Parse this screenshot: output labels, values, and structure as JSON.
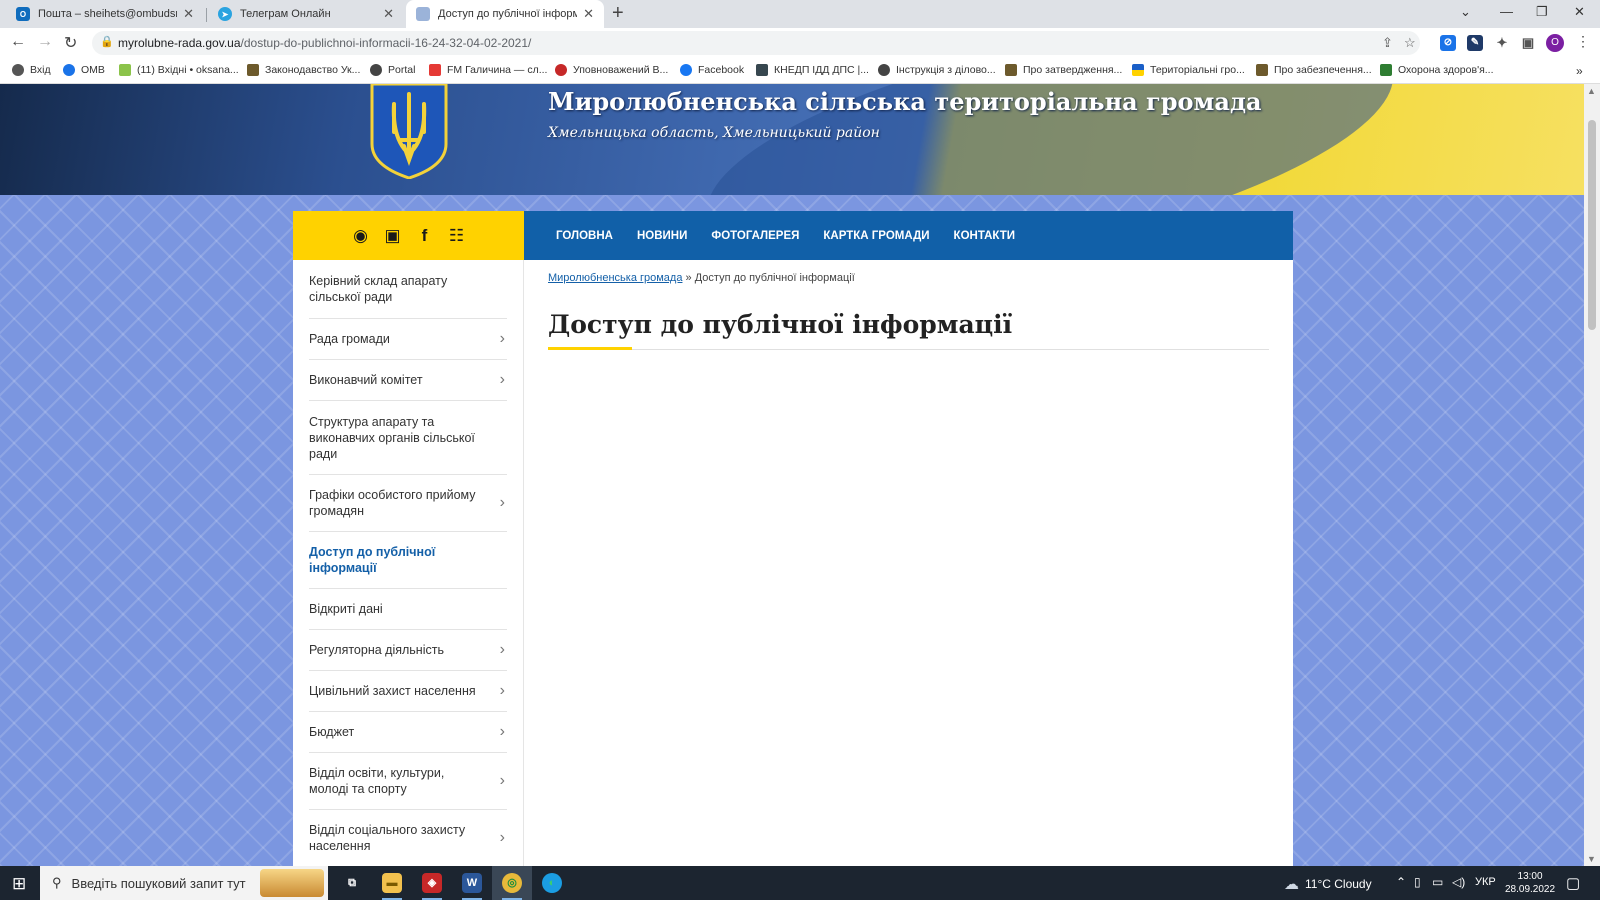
{
  "browser": {
    "tabs": [
      {
        "label": "Пошта – sheihets@ombudsman.",
        "favicon": "outlook-icon",
        "color": "#0f6cbd"
      },
      {
        "label": "Телеграм Онлайн",
        "favicon": "telegram-icon",
        "color": "#2aa3e0"
      },
      {
        "label": "Доступ до публічної інформації",
        "favicon": "page-icon",
        "color": "#9bb3d9"
      }
    ],
    "close_glyph": "✕",
    "new_tab_glyph": "+",
    "window_controls": {
      "tab_search": "⌄",
      "minimize": "—",
      "restore": "❐",
      "close": "✕"
    },
    "nav": {
      "back": "←",
      "forward": "→",
      "reload": "↻"
    },
    "url_host": "myrolubne-rada.gov.ua",
    "url_path": "/dostup-do-publichnoi-informacii-16-24-32-04-02-2021/",
    "omnibox_icons": {
      "lock": "🔒",
      "share": "⇪",
      "star": "☆"
    },
    "extensions": [
      {
        "name": "cloud-extension-icon",
        "glyph": "⊘",
        "color": "#1a73e8"
      },
      {
        "name": "edit-extension-icon",
        "glyph": "✎",
        "color": "#1f3a68"
      },
      {
        "name": "puzzle-icon",
        "glyph": "✦",
        "color": "#555555"
      },
      {
        "name": "sidepanel-icon",
        "glyph": "▣",
        "color": "#555555"
      }
    ],
    "profile_initial": "O",
    "menu_glyph": "⋮",
    "bookmarks": [
      {
        "label": "Вхід",
        "color": "#555555"
      },
      {
        "label": "OMB",
        "color": "#1a73e8"
      },
      {
        "label": "(11) Вхідні • oksana...",
        "color": "#8bc34a"
      },
      {
        "label": "Законодавство Ук...",
        "color": "#6d5a2c"
      },
      {
        "label": "Portal",
        "color": "#444444"
      },
      {
        "label": "FM Галичина — сл...",
        "color": "#e53935"
      },
      {
        "label": "Уповноважений В...",
        "color": "#c62828"
      },
      {
        "label": "Facebook",
        "color": "#1877f2"
      },
      {
        "label": "КНЕДП ІДД ДПС |...",
        "color": "#37474f"
      },
      {
        "label": "Інструкція з ділово...",
        "color": "#444444"
      },
      {
        "label": "Про затвердження...",
        "color": "#6d5a2c"
      },
      {
        "label": "Територіальні гро...",
        "color": "#ffd200"
      },
      {
        "label": "Про забезпечення...",
        "color": "#6d5a2c"
      },
      {
        "label": "Охорона здоров'я...",
        "color": "#2e7d32"
      }
    ],
    "bookmarks_more": "»"
  },
  "site": {
    "title": "Миролюбненська сільська територіальна громада",
    "subtitle": "Хмельницька область, Хмельницький район",
    "social_icons": [
      {
        "name": "rss-icon",
        "glyph": "◉"
      },
      {
        "name": "robot-icon",
        "glyph": "▣"
      },
      {
        "name": "facebook-icon",
        "glyph": "f"
      },
      {
        "name": "sitemap-icon",
        "glyph": "☷"
      }
    ],
    "nav": [
      "Головна",
      "Новини",
      "Фотогалерея",
      "Картка громади",
      "Контакти"
    ],
    "sidebar": [
      {
        "label": "Керівний склад апарату сільської ради",
        "chevron": false,
        "active": false,
        "height": 59
      },
      {
        "label": "Рада громади",
        "chevron": true,
        "active": false,
        "height": 41
      },
      {
        "label": "Виконавчий комітет",
        "chevron": true,
        "active": false,
        "height": 41
      },
      {
        "label": "Структура апарату та виконавчих органів сільської ради",
        "chevron": false,
        "active": false,
        "height": 74
      },
      {
        "label": "Графіки особистого прийому громадян",
        "chevron": true,
        "active": false,
        "height": 57
      },
      {
        "label": "Доступ до публічної інформації",
        "chevron": false,
        "active": true,
        "height": 57
      },
      {
        "label": "Відкриті дані",
        "chevron": false,
        "active": false,
        "height": 41
      },
      {
        "label": "Регуляторна діяльність",
        "chevron": true,
        "active": false,
        "height": 41
      },
      {
        "label": "Цивільний захист населення",
        "chevron": true,
        "active": false,
        "height": 41
      },
      {
        "label": "Бюджет",
        "chevron": true,
        "active": false,
        "height": 41
      },
      {
        "label": "Відділ освіти, культури, молоді та спорту",
        "chevron": true,
        "active": false,
        "height": 57
      },
      {
        "label": "Відділ соціального захисту населення",
        "chevron": true,
        "active": false,
        "height": 57
      }
    ],
    "chevron_glyph": "›",
    "breadcrumb": {
      "home": "Миролюбненська громада",
      "separator": "»",
      "current": "Доступ до публічної інформації"
    },
    "page_title": "Доступ до публічної інформації",
    "colors": {
      "accent_yellow": "#ffd200",
      "nav_blue": "#1160a8",
      "link_blue": "#1460a8"
    }
  },
  "taskbar": {
    "start_glyph": "⊞",
    "search_placeholder": "Введіть пошуковий запит тут",
    "search_glyph": "⚲",
    "apps": [
      {
        "name": "task-view-icon",
        "glyph": "⧉",
        "bg": "transparent",
        "fg": "#ffffff",
        "running": false
      },
      {
        "name": "file-explorer-icon",
        "glyph": "▬",
        "bg": "#f2c14e",
        "fg": "#7a5a00",
        "running": true
      },
      {
        "name": "security-app-icon",
        "glyph": "◈",
        "bg": "#c62828",
        "fg": "#ffffff",
        "running": true
      },
      {
        "name": "word-icon",
        "glyph": "W",
        "bg": "#2b579a",
        "fg": "#ffffff",
        "running": true
      },
      {
        "name": "chrome-icon",
        "glyph": "◎",
        "bg": "#e8b93a",
        "fg": "#1e8e3e",
        "running": true
      },
      {
        "name": "edge-icon",
        "glyph": "◐",
        "bg": "#1b9de2",
        "fg": "#3ccf6e",
        "running": false
      }
    ],
    "weather_glyph": "☁",
    "weather": "11°C  Cloudy",
    "tray": {
      "up": "⌃",
      "network": "▭",
      "display": "▯",
      "volume": "◁)"
    },
    "lang": "УКР",
    "time": "13:00",
    "date": "28.09.2022",
    "notification_glyph": "▢"
  }
}
